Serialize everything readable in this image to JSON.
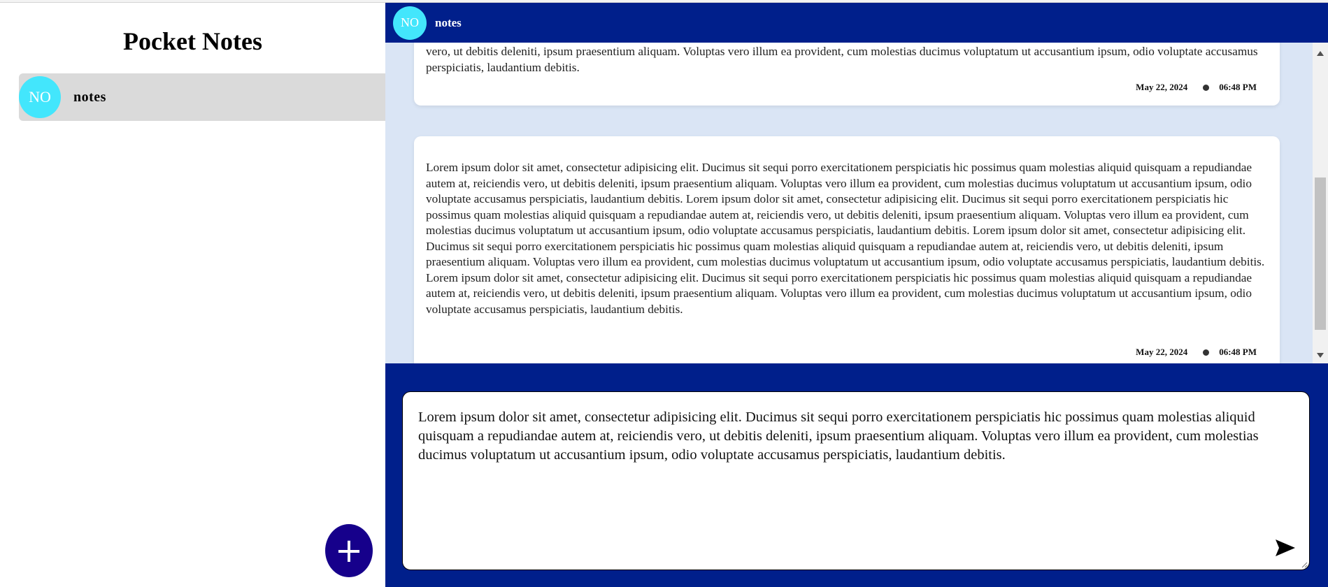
{
  "app": {
    "title": "Pocket Notes"
  },
  "sidebar": {
    "groups": [
      {
        "initials": "NO",
        "name": "notes",
        "color": "#43e6fc"
      }
    ],
    "add_button_label": "+"
  },
  "header": {
    "initials": "NO",
    "title": "notes"
  },
  "notes": [
    {
      "text": "vero, ut debitis deleniti, ipsum praesentium aliquam. Voluptas vero illum ea provident, cum molestias ducimus voluptatum ut accusantium ipsum, odio voluptate accusamus perspiciatis, laudantium debitis.",
      "date": "May 22, 2024",
      "time": "06:48 PM"
    },
    {
      "text": "Lorem ipsum dolor sit amet, consectetur adipisicing elit. Ducimus sit sequi porro exercitationem perspiciatis hic possimus quam molestias aliquid quisquam a repudiandae autem at, reiciendis vero, ut debitis deleniti, ipsum praesentium aliquam. Voluptas vero illum ea provident, cum molestias ducimus voluptatum ut accusantium ipsum, odio voluptate accusamus perspiciatis, laudantium debitis. Lorem ipsum dolor sit amet, consectetur adipisicing elit. Ducimus sit sequi porro exercitationem perspiciatis hic possimus quam molestias aliquid quisquam a repudiandae autem at, reiciendis vero, ut debitis deleniti, ipsum praesentium aliquam. Voluptas vero illum ea provident, cum molestias ducimus voluptatum ut accusantium ipsum, odio voluptate accusamus perspiciatis, laudantium debitis. Lorem ipsum dolor sit amet, consectetur adipisicing elit. Ducimus sit sequi porro exercitationem perspiciatis hic possimus quam molestias aliquid quisquam a repudiandae autem at, reiciendis vero, ut debitis deleniti, ipsum praesentium aliquam. Voluptas vero illum ea provident, cum molestias ducimus voluptatum ut accusantium ipsum, odio voluptate accusamus perspiciatis, laudantium debitis. Lorem ipsum dolor sit amet, consectetur adipisicing elit. Ducimus sit sequi porro exercitationem perspiciatis hic possimus quam molestias aliquid quisquam a repudiandae autem at, reiciendis vero, ut debitis deleniti, ipsum praesentium aliquam. Voluptas vero illum ea provident, cum molestias ducimus voluptatum ut accusantium ipsum, odio voluptate accusamus perspiciatis, laudantium debitis.",
      "date": "May 22, 2024",
      "time": "06:48 PM"
    }
  ],
  "composer": {
    "value": "Lorem ipsum dolor sit amet, consectetur adipisicing elit. Ducimus sit sequi porro exercitationem perspiciatis hic possimus quam molestias aliquid quisquam a repudiandae autem at, reiciendis vero, ut debitis deleniti, ipsum praesentium aliquam. Voluptas vero illum ea provident, cum molestias ducimus voluptatum ut accusantium ipsum, odio voluptate accusamus perspiciatis, laudantium debitis.\n",
    "send_icon": "send-arrow-icon"
  },
  "colors": {
    "header_bg": "#001f8b",
    "fab_bg": "#16008b",
    "avatar_bg": "#43e6fc",
    "notes_bg": "#dae5f5",
    "selected_group_bg": "#dadada"
  }
}
